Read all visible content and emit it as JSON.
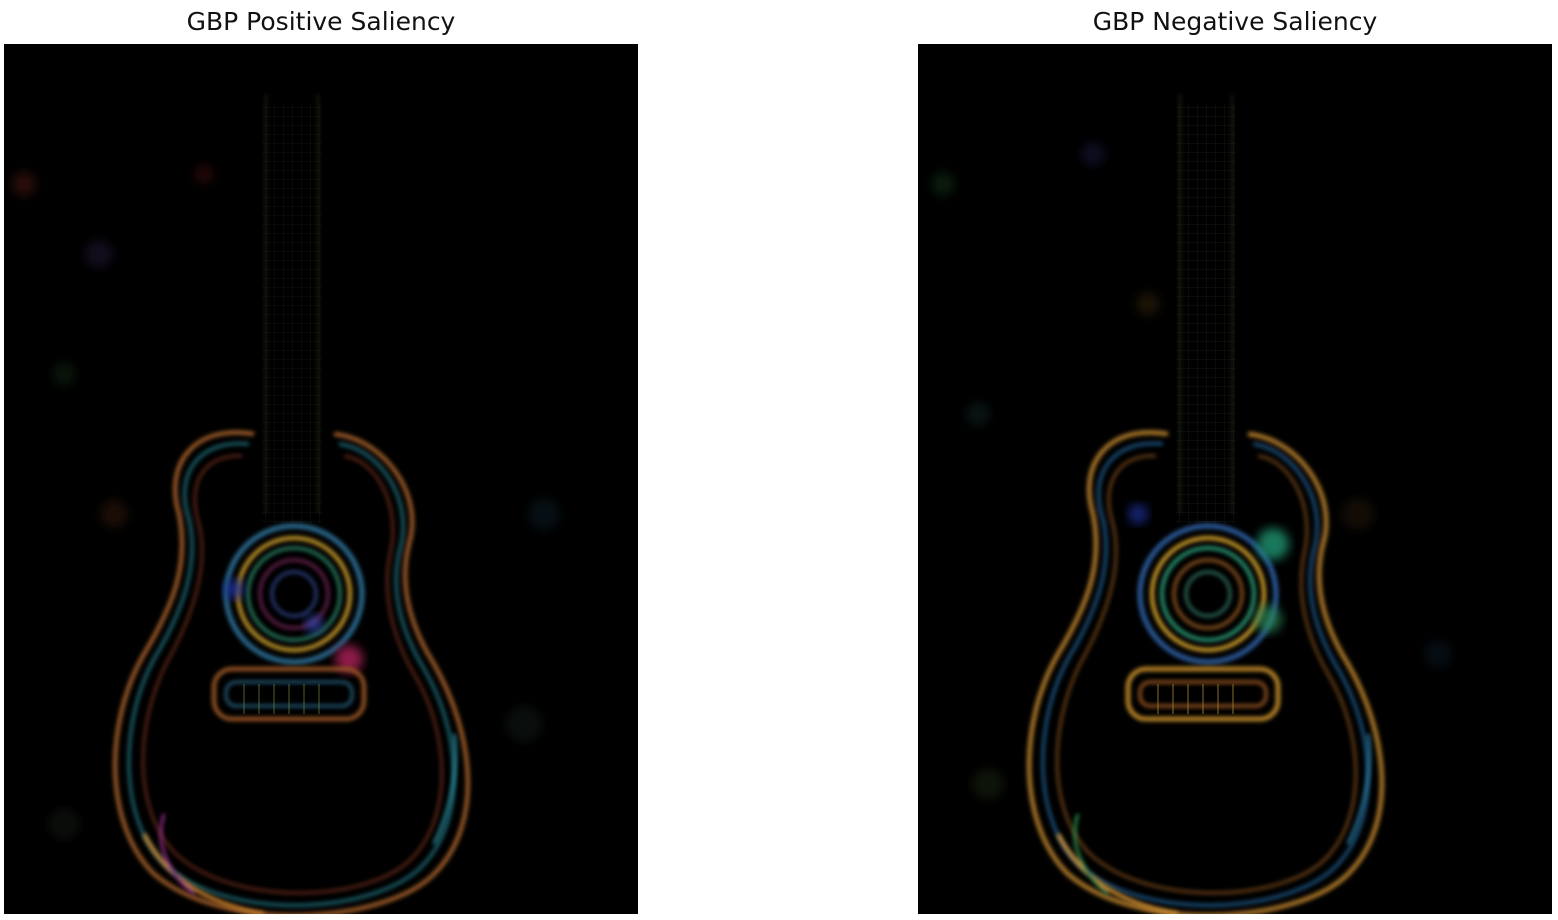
{
  "panels": [
    {
      "title": "GBP Positive Saliency",
      "image": "saliency-map-guitar"
    },
    {
      "title": "GBP Negative Saliency",
      "image": "saliency-map-guitar"
    }
  ]
}
